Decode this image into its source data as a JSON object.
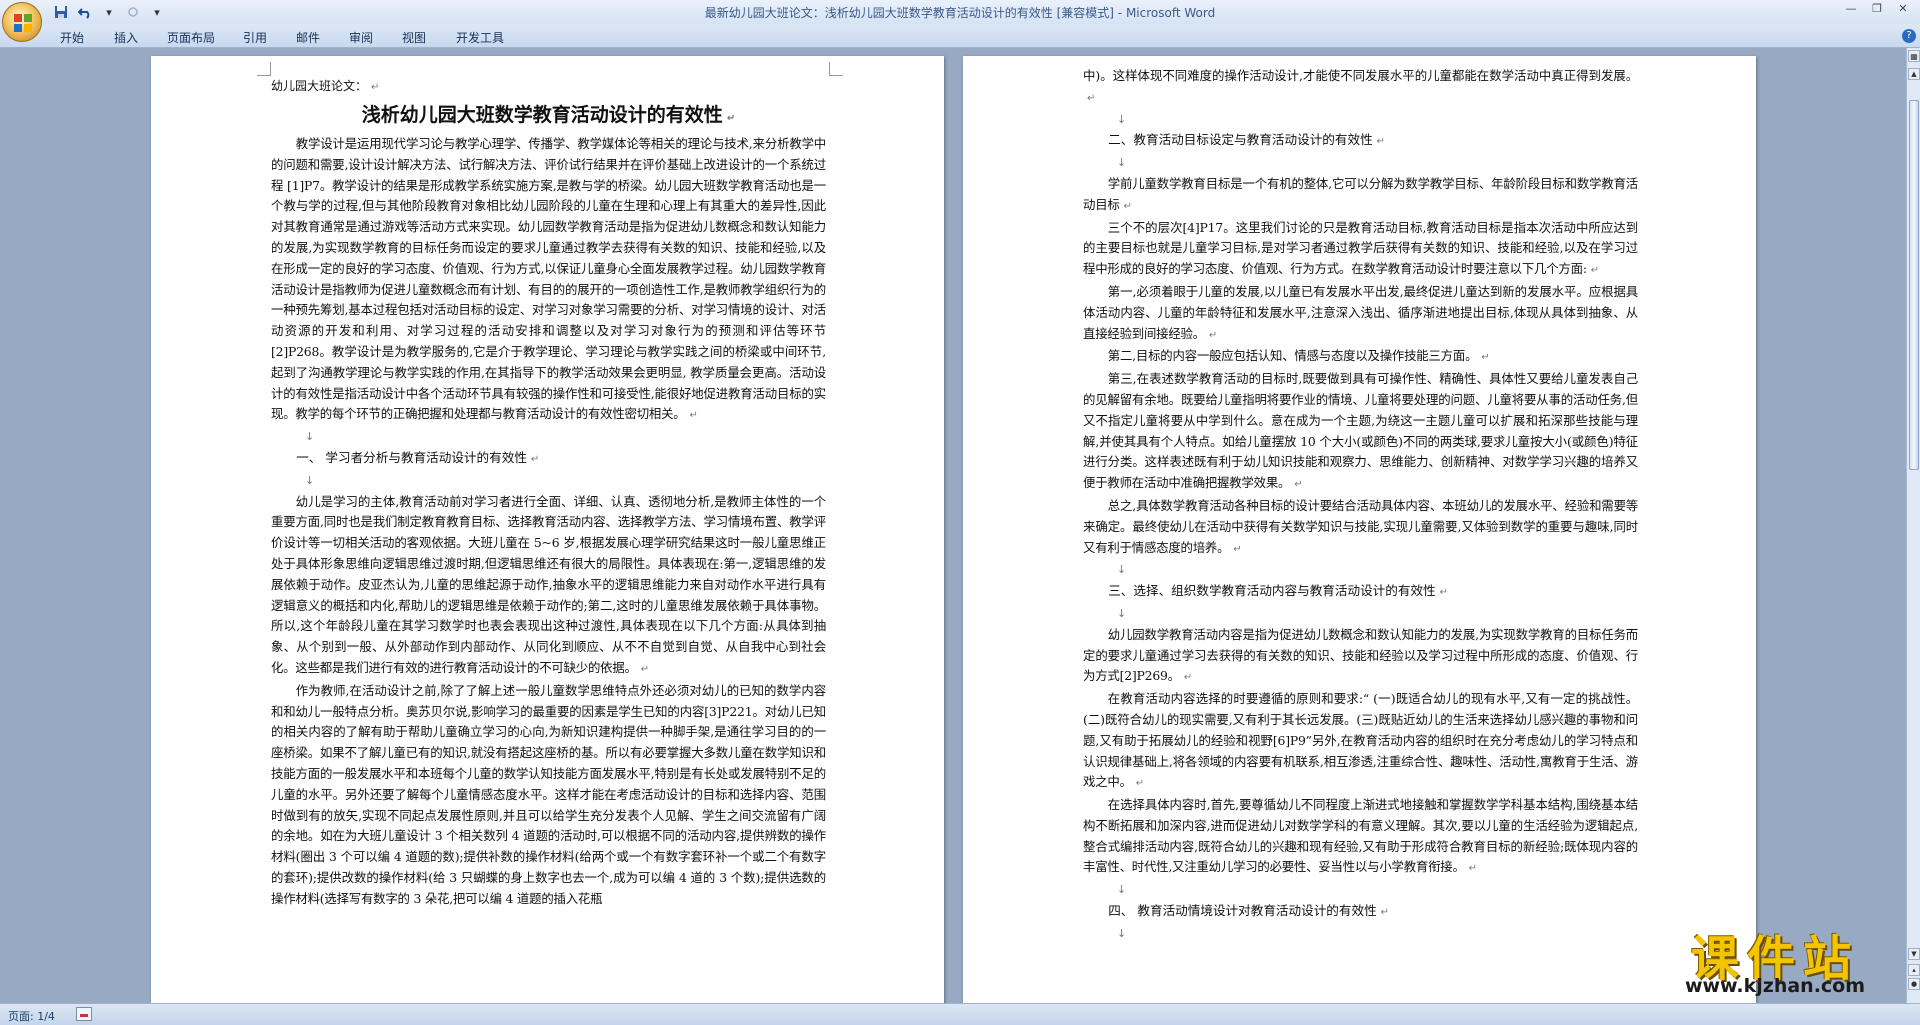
{
  "window": {
    "title_doc": "最新幼儿园大班论文：浅析幼儿园大班数学教育活动设计的有效性 [兼容模式]",
    "title_sep": " - ",
    "title_app": "Microsoft Word"
  },
  "ribbon": {
    "tabs": [
      "开始",
      "插入",
      "页面布局",
      "引用",
      "邮件",
      "审阅",
      "视图",
      "开发工具"
    ]
  },
  "status": {
    "page_indicator": "页面: 1/4"
  },
  "watermark": {
    "cn": "课件站",
    "url": "www.kjzhan.com"
  },
  "doc": {
    "left": {
      "label": "幼儿园大班论文：",
      "title": "浅析幼儿园大班数学教育活动设计的有效性",
      "p1": "教学设计是运用现代学习论与教学心理学、传播学、教学媒体论等相关的理论与技术,来分析教学中的问题和需要,设计设计解决方法、试行解决方法、评价试行结果并在评价基础上改进设计的一个系统过程 [1]P7。教学设计的结果是形成教学系统实施方案,是教与学的桥梁。幼儿园大班数学教育活动也是一个教与学的过程,但与其他阶段教育对象相比幼儿园阶段的儿童在生理和心理上有其重大的差异性,因此对其教育通常是通过游戏等活动方式来实现。幼儿园数学教育活动是指为促进幼儿数概念和数认知能力的发展,为实现数学教育的目标任务而设定的要求儿童通过教学去获得有关数的知识、技能和经验,以及在形成一定的良好的学习态度、价值观、行为方式,以保证儿童身心全面发展教学过程。幼儿园数学教育活动设计是指教师为促进儿童数概念而有计划、有目的的展开的一项创造性工作,是教师教学组织行为的一种预先筹划,基本过程包括对活动目标的设定、对学习对象学习需要的分析、对学习情境的设计、对活动资源的开发和利用、对学习过程的活动安排和调整以及对学习对象行为的预测和评估等环节[2]P268。教学设计是为教学服务的,它是介于教学理论、学习理论与教学实践之间的桥梁或中间环节, 起到了沟通教学理论与教学实践的作用,在其指导下的教学活动效果会更明显, 教学质量会更高。活动设计的有效性是指活动设计中各个活动环节具有较强的操作性和可接受性,能很好地促进教育活动目标的实现。教学的每个环节的正确把握和处理都与教育活动设计的有效性密切相关。",
      "h1": "一、 学习者分析与教育活动设计的有效性",
      "p2": "幼儿是学习的主体,教育活动前对学习者进行全面、详细、认真、透彻地分析,是教师主体性的一个重要方面,同时也是我们制定教育教育目标、选择教育活动内容、选择教学方法、学习情境布置、教学评价设计等一切相关活动的客观依据。大班儿童在 5~6 岁,根据发展心理学研究结果这时一般儿童思维正处于具体形象思维向逻辑思维过渡时期,但逻辑思维还有很大的局限性。具体表现在:第一,逻辑思维的发展依赖于动作。皮亚杰认为,儿童的思维起源于动作,抽象水平的逻辑思维能力来自对动作水平进行具有逻辑意义的概括和内化,帮助儿的逻辑思维是依赖于动作的;第二,这时的儿童思维发展依赖于具体事物。所以,这个年龄段儿童在其学习数学时也表会表现出这种过渡性,具体表现在以下几个方面:从具体到抽象、从个别到一般、从外部动作到内部动作、从同化到顺应、从不不自觉到自觉、从自我中心到社会化。这些都是我们进行有效的进行教育活动设计的不可缺少的依据。",
      "p3": "作为教师,在活动设计之前,除了了解上述一般儿童数学思维特点外还必须对幼儿的已知的数学内容和和幼儿一般特点分析。奥苏贝尔说,影响学习的最重要的因素是学生已知的内容[3]P221。对幼儿已知的相关内容的了解有助于帮助儿童确立学习的心向,为新知识建构提供一种脚手架,是通往学习目的的一座桥梁。如果不了解儿童已有的知识,就没有搭起这座桥的基。所以有必要掌握大多数儿童在数学知识和技能方面的一般发展水平和本班每个儿童的数学认知技能方面发展水平,特别是有长处或发展特别不足的儿童的水平。另外还要了解每个儿童情感态度水平。这样才能在考虑活动设计的目标和选择内容、范围时做到有的放矢,实现不同起点发展性原则,并且可以给学生充分发表个人见解、学生之间交流留有广阔的余地。如在为大班儿童设计 3 个相关数列 4 道题的活动时,可以根据不同的活动内容,提供辨数的操作材料(圈出 3 个可以编 4 道题的数);提供补数的操作材料(给两个或一个有数字套环补一个或二个有数字的套环);提供改数的操作材料(给 3 只蝴蝶的身上数字也去一个,成为可以编 4 道的 3 个数);提供选数的操作材料(选择写有数字的 3 朵花,把可以编 4 道题的插入花瓶"
    },
    "right": {
      "p0": "中)。这样体现不同难度的操作活动设计,才能使不同发展水平的儿童都能在数学活动中真正得到发展。",
      "h2": "二、教育活动目标设定与教育活动设计的有效性",
      "p1": "学前儿童数学教育目标是一个有机的整体,它可以分解为数学教学目标、年龄阶段目标和数学教育活动目标",
      "p2": "三个不的层次[4]P17。这里我们讨论的只是教育活动目标,教育活动目标是指本次活动中所应达到的主要目标也就是儿童学习目标,是对学习者通过教学后获得有关数的知识、技能和经验,以及在学习过程中形成的良好的学习态度、价值观、行为方式。在数学教育活动设计时要注意以下几个方面:",
      "p3": "第一,必须着眼于儿童的发展,以儿童已有发展水平出发,最终促进儿童达到新的发展水平。应根据具体活动内容、儿童的年龄特征和发展水平,注意深入浅出、循序渐进地提出目标,体现从具体到抽象、从直接经验到间接经验。",
      "p4": "第二,目标的内容一般应包括认知、情感与态度以及操作技能三方面。",
      "p5": "第三,在表述数学教育活动的目标时,既要做到具有可操作性、精确性、具体性又要给儿童发表自己的见解留有余地。既要给儿童指明将要作业的情境、儿童将要处理的问题、儿童将要从事的活动任务,但又不指定儿童将要从中学到什么。意在成为一个主题,为绕这一主题儿童可以扩展和拓深那些技能与理解,并使其具有个人特点。如给儿童摆放 10 个大小(或颜色)不同的两类球,要求儿童按大小(或颜色)特征进行分类。这样表述既有利于幼儿知识技能和观察力、思维能力、创新精神、对数学学习兴趣的培养又便于教师在活动中准确把握教学效果。",
      "p6": "总之,具体数学教育活动各种目标的设计要结合活动具体内容、本班幼儿的发展水平、经验和需要等来确定。最终使幼儿在活动中获得有关数学知识与技能,实现儿童需要,又体验到数学的重要与趣味,同时又有利于情感态度的培养。",
      "h3": "三、选择、组织数学教育活动内容与教育活动设计的有效性",
      "p7": "幼儿园数学教育活动内容是指为促进幼儿数概念和数认知能力的发展,为实现数学教育的目标任务而定的要求儿童通过学习去获得的有关数的知识、技能和经验以及学习过程中所形成的态度、价值观、行为方式[2]P269。",
      "p8": "在教育活动内容选择的时要遵循的原则和要求:“ (一)既适合幼儿的现有水平,又有一定的挑战性。(二)既符合幼儿的现实需要,又有利于其长远发展。(三)既贴近幼儿的生活来选择幼儿感兴趣的事物和问题,又有助于拓展幼儿的经验和视野[6]P9”另外,在教育活动内容的组织时在充分考虑幼儿的学习特点和认识规律基础上,将各领域的内容要有机联系,相互渗透,注重综合性、趣味性、活动性,寓教育于生活、游戏之中。",
      "p9": "在选择具体内容时,首先,要尊循幼儿不同程度上渐进式地接触和掌握数学学科基本结构,围绕基本结构不断拓展和加深内容,进而促进幼儿对数学学科的有意义理解。其次,要以儿童的生活经验为逻辑起点,整合式编排活动内容,既符合幼儿的兴趣和现有经验,又有助于形成符合教育目标的新经验;既体现内容的丰富性、时代性,又注重幼儿学习的必要性、妥当性以与小学教育衔接。",
      "h4": "四、 教育活动情境设计对教育活动设计的有效性"
    }
  }
}
